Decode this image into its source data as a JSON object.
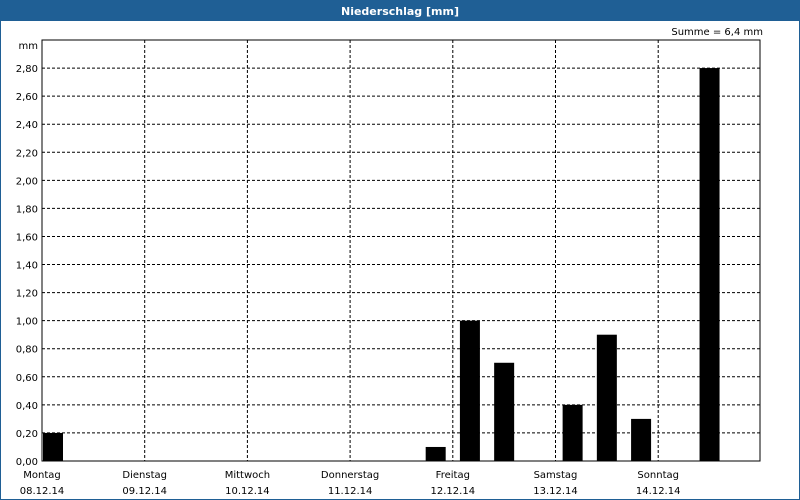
{
  "window": {
    "title": "Niederschlag [mm]"
  },
  "chart_data": {
    "type": "bar",
    "title": "Niederschlag [mm]",
    "ylabel": "mm",
    "summary": "Summe = 6,4 mm",
    "ylim": [
      0,
      3.0
    ],
    "yticks": [
      "0,00",
      "0,20",
      "0,40",
      "0,60",
      "0,80",
      "1,00",
      "1,20",
      "1,40",
      "1,60",
      "1,80",
      "2,00",
      "2,20",
      "2,40",
      "2,60",
      "2,80"
    ],
    "days": [
      {
        "name": "Montag",
        "date": "08.12.14"
      },
      {
        "name": "Dienstag",
        "date": "09.12.14"
      },
      {
        "name": "Mittwoch",
        "date": "10.12.14"
      },
      {
        "name": "Donnerstag",
        "date": "11.12.14"
      },
      {
        "name": "Freitag",
        "date": "12.12.14"
      },
      {
        "name": "Samstag",
        "date": "13.12.14"
      },
      {
        "name": "Sonntag",
        "date": "14.12.14"
      }
    ],
    "bar_interval_hours": 8,
    "values": [
      0.2,
      0,
      0,
      0,
      0,
      0,
      0,
      0,
      0,
      0,
      0,
      0.1,
      1.0,
      0.7,
      0,
      0.4,
      0.9,
      0.3,
      0,
      2.8,
      0
    ],
    "grid": true,
    "bar_color": "#000000"
  }
}
